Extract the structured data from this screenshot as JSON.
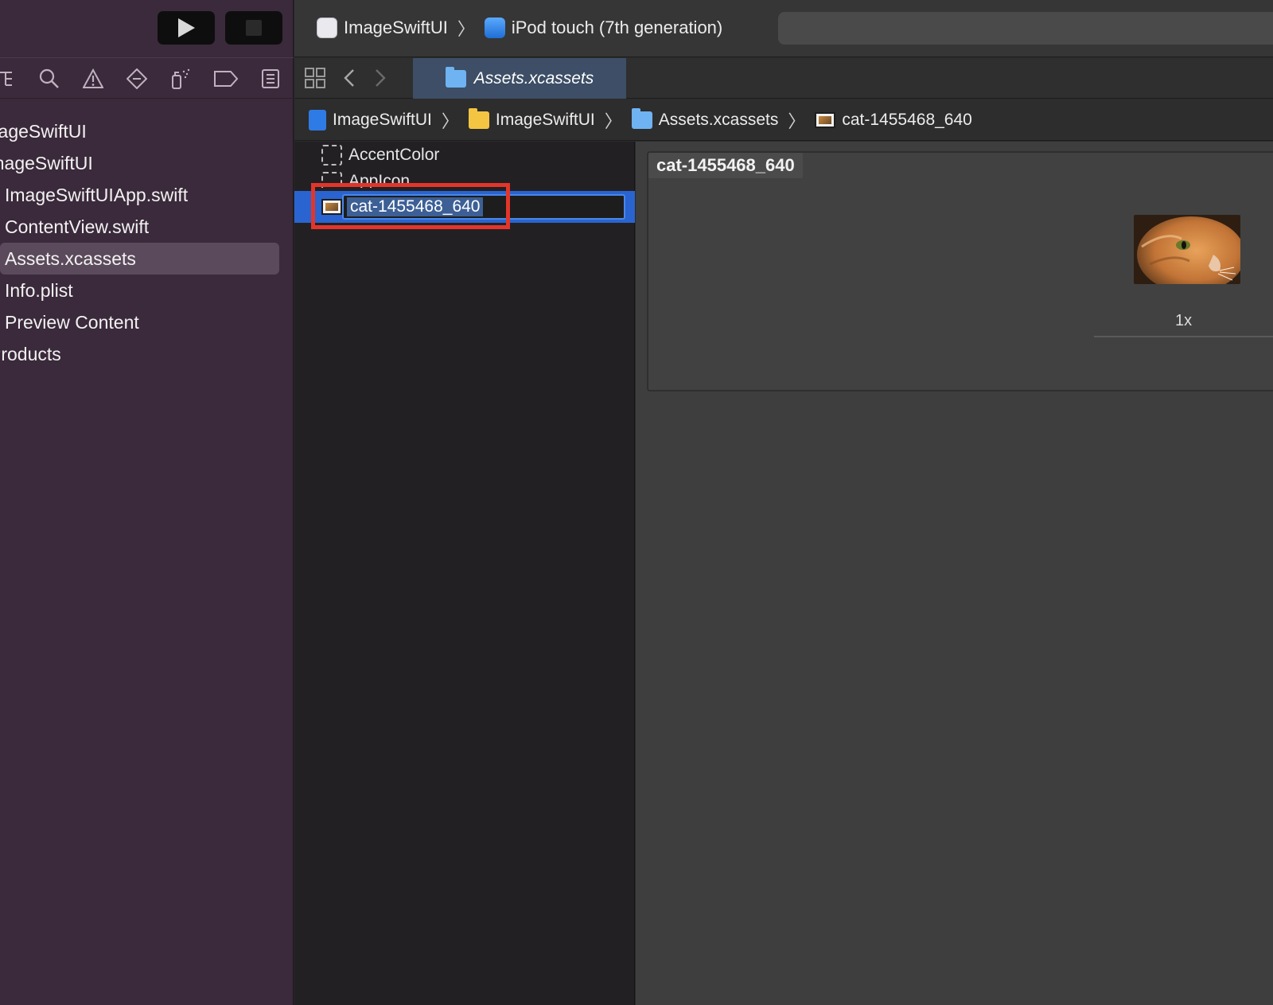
{
  "toolbar": {
    "scheme_target": "ImageSwiftUI",
    "device": "iPod touch (7th generation)",
    "run_label": "▶",
    "stop_label": "■"
  },
  "navigator": {
    "items": [
      {
        "label": "ImageSwiftUI",
        "depth": 0
      },
      {
        "label": "ImageSwiftUI",
        "depth": 1
      },
      {
        "label": "ImageSwiftUIApp.swift",
        "depth": 2
      },
      {
        "label": "ContentView.swift",
        "depth": 2
      },
      {
        "label": "Assets.xcassets",
        "depth": 2,
        "selected": true
      },
      {
        "label": "Info.plist",
        "depth": 2
      },
      {
        "label": "Preview Content",
        "depth": 2
      },
      {
        "label": "Products",
        "depth": 0
      }
    ]
  },
  "editor": {
    "tab_label": "Assets.xcassets",
    "breadcrumb": [
      "ImageSwiftUI",
      "ImageSwiftUI",
      "Assets.xcassets",
      "cat-1455468_640"
    ]
  },
  "asset_catalog": {
    "items": [
      "AccentColor",
      "AppIcon",
      "cat-1455468_640"
    ],
    "renaming_value": "cat-1455468_640"
  },
  "asset_detail": {
    "title": "cat-1455468_640",
    "scale_label": "1x"
  },
  "colors": {
    "sidebar_bg": "#3b2a3b",
    "selection_blue": "#2a64d0",
    "highlight_red": "#e3352a",
    "tab_bg": "#3d4e66"
  }
}
